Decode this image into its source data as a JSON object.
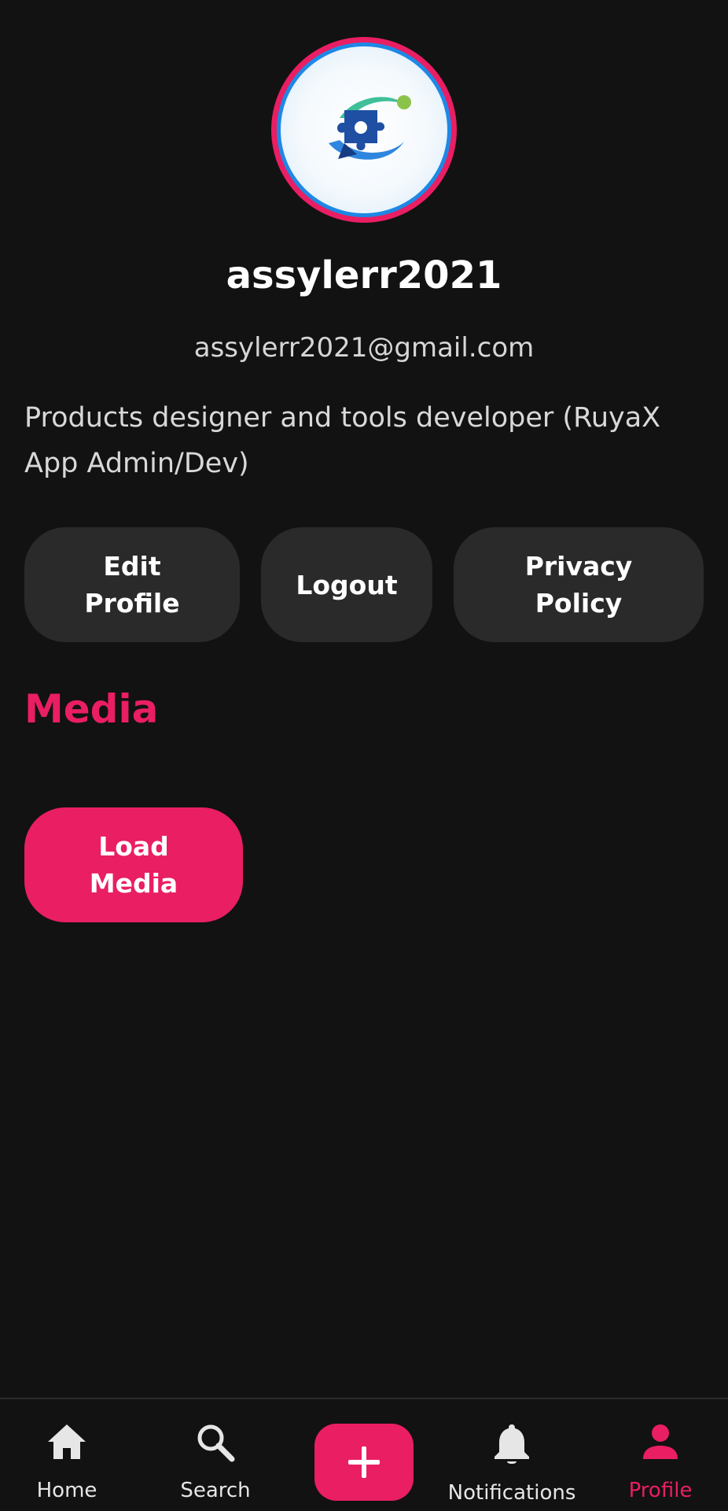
{
  "profile": {
    "username": "assylerr2021",
    "email": "assylerr2021@gmail.com",
    "bio": "Products designer and tools developer (RuyaX App Admin/Dev)"
  },
  "actions": {
    "edit_profile": "Edit\nProfile",
    "logout": "Logout",
    "privacy_policy": "Privacy\nPolicy"
  },
  "media": {
    "title": "Media",
    "load_button": "Load\nMedia"
  },
  "bottom_nav": {
    "items": [
      {
        "label": "Home",
        "icon": "home-icon"
      },
      {
        "label": "Search",
        "icon": "search-icon"
      },
      {
        "label": "",
        "icon": "plus-icon"
      },
      {
        "label": "Notifications",
        "icon": "bell-icon"
      },
      {
        "label": "Profile",
        "icon": "person-icon",
        "active": true
      }
    ]
  },
  "colors": {
    "accent": "#e91e63",
    "background": "#121212",
    "surface": "#2a2a2a",
    "text": "#ffffff"
  }
}
